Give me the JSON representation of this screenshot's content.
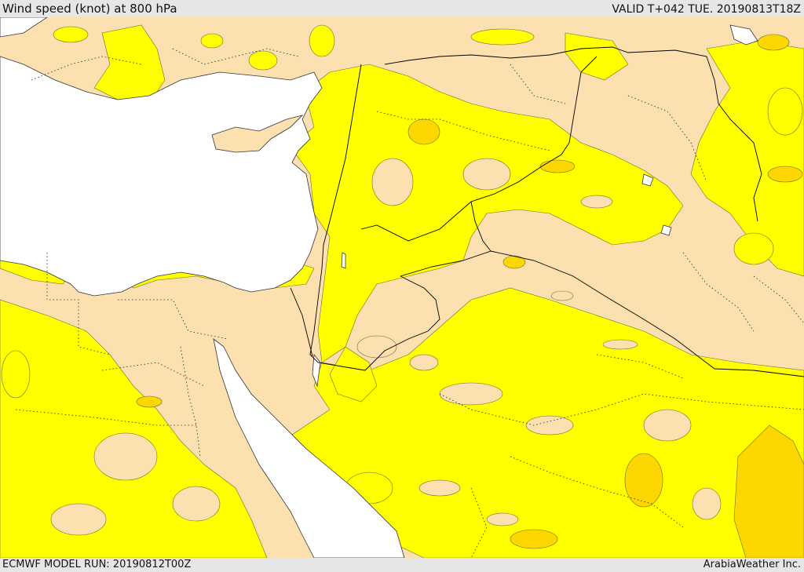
{
  "header": {
    "title": "Wind speed (knot) at 800 hPa",
    "valid_time": "VALID T+042 TUE. 20190813T18Z"
  },
  "footer": {
    "model_run": "ECMWF MODEL RUN: 20190812T00Z",
    "credit": "ArabiaWeather Inc."
  },
  "colors": {
    "land_low_wind": "#fde0b0",
    "wind_band_1": "#ffff00",
    "wind_band_2": "#ffd700",
    "sea": "#ffffff",
    "border": "#000000",
    "background": "#e6e6e6"
  }
}
